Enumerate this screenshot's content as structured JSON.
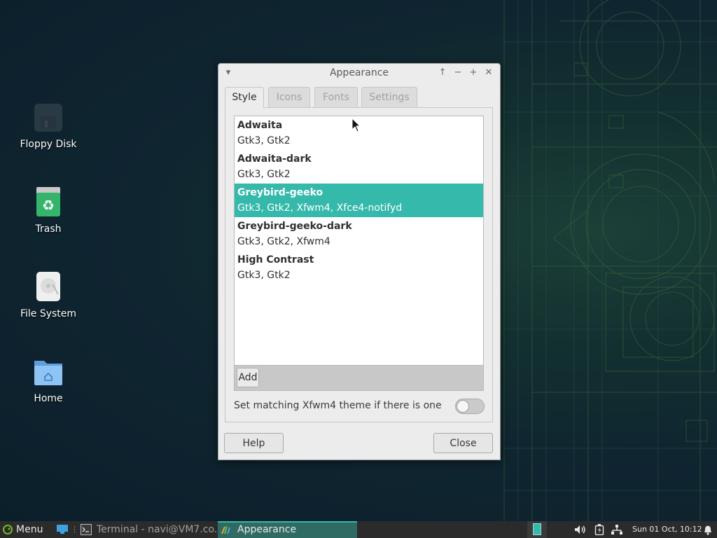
{
  "desktop": {
    "icons": [
      {
        "label": "Floppy Disk",
        "icon": "floppy-disk-icon"
      },
      {
        "label": "Trash",
        "icon": "trash-icon"
      },
      {
        "label": "File System",
        "icon": "hard-drive-icon"
      },
      {
        "label": "Home",
        "icon": "home-folder-icon"
      }
    ]
  },
  "window": {
    "title": "Appearance",
    "tabs": [
      {
        "label": "Style",
        "active": true
      },
      {
        "label": "Icons",
        "active": false
      },
      {
        "label": "Fonts",
        "active": false
      },
      {
        "label": "Settings",
        "active": false
      }
    ],
    "themes": [
      {
        "name": "Adwaita",
        "engines": "Gtk3, Gtk2",
        "selected": false
      },
      {
        "name": "Adwaita-dark",
        "engines": "Gtk3, Gtk2",
        "selected": false
      },
      {
        "name": "Greybird-geeko",
        "engines": "Gtk3, Gtk2, Xfwm4, Xfce4-notifyd",
        "selected": true
      },
      {
        "name": "Greybird-geeko-dark",
        "engines": "Gtk3, Gtk2, Xfwm4",
        "selected": false
      },
      {
        "name": "High Contrast",
        "engines": "Gtk3, Gtk2",
        "selected": false
      }
    ],
    "add_label": "Add",
    "match_xfwm4_label": "Set matching Xfwm4 theme if there is one",
    "match_xfwm4_enabled": false,
    "help_label": "Help",
    "close_label": "Close",
    "selection_color": "#35b9ab"
  },
  "taskbar": {
    "menu_label": "Menu",
    "tasks": [
      {
        "label": "Terminal - navi@VM7.co...",
        "icon": "terminal-icon",
        "active": false
      },
      {
        "label": "Appearance",
        "icon": "appearance-icon",
        "active": true
      }
    ],
    "clock": "Sun 01 Oct, 10:12"
  }
}
